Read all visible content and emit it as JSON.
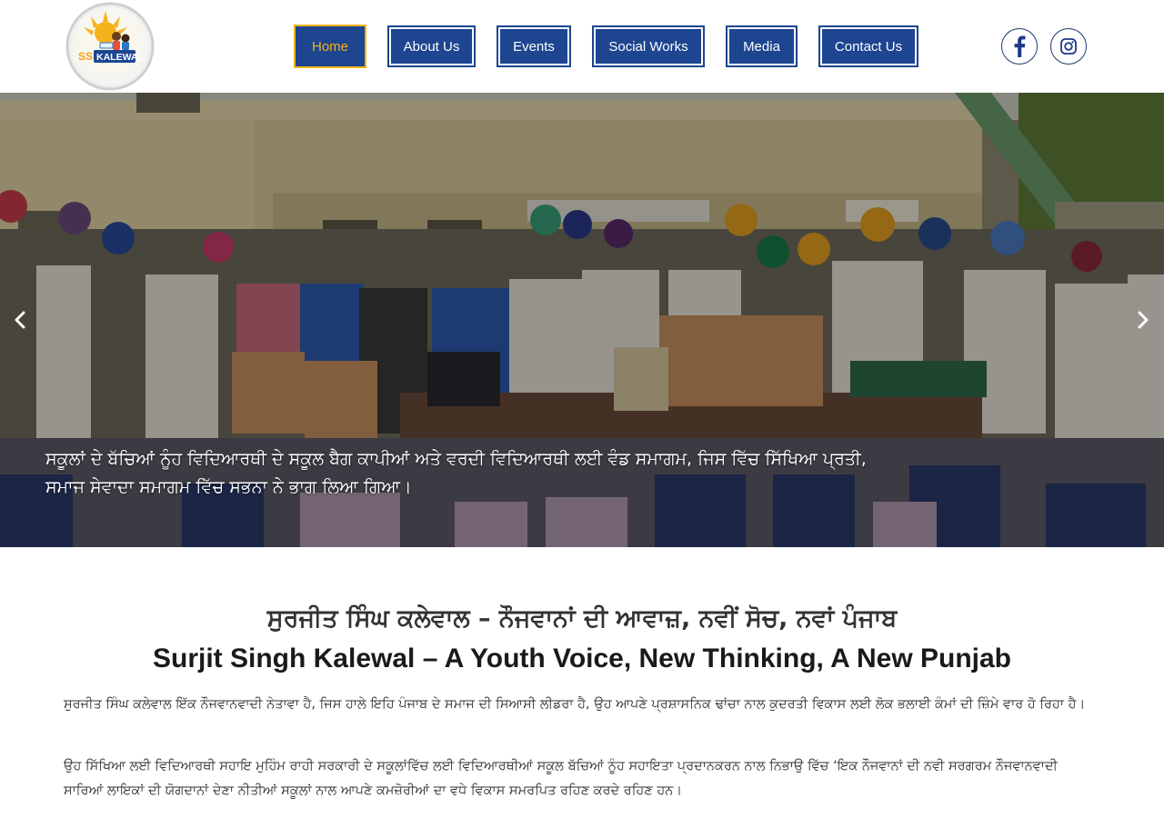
{
  "brand": {
    "logo_text": "SS KALEWAL"
  },
  "nav": {
    "items": [
      {
        "label": "Home",
        "active": true
      },
      {
        "label": "About Us"
      },
      {
        "label": "Events"
      },
      {
        "label": "Social Works"
      },
      {
        "label": "Media"
      },
      {
        "label": "Contact Us"
      }
    ]
  },
  "social": {
    "facebook_icon": "facebook-icon",
    "instagram_icon": "instagram-icon"
  },
  "hero": {
    "caption": "ਸਕੂਲਾਂ ਦੇ ਬੱਚਿਆਂ ਨੂੰਹ ਵਿਦਿਆਰਥੀ ਦੇ ਸਕੂਲ ਬੈਗ ਕਾਪੀਆਂ ਅਤੇ ਵਰਦੀ ਵਿਦਿਆਰਥੀ ਲਈ ਵੰਡ ਸਮਾਗਮ, ਜਿਸ ਵਿੱਚ ਸਿੱਖਿਆ ਪ੍ਰਤੀ, ਸਮਾਜ ਸੇਵਾਦਾ ਸਮਾਗਮ ਵਿੱਚ ਸਭਨਾ ਨੇ ਭਾਗ ਲਿਆ ਗਿਆ।",
    "prev_icon": "chevron-left-icon",
    "next_icon": "chevron-right-icon"
  },
  "intro": {
    "title_pa": "ਸੁਰਜੀਤ ਸਿੰਘ ਕਲੇਵਾਲ – ਨੌਜਵਾਨਾਂ ਦੀ ਆਵਾਜ਼, ਨਵੀਂ ਸੋਚ, ਨਵਾਂ ਪੰਜਾਬ",
    "title_en": "Surjit Singh Kalewal – A Youth Voice, New Thinking, A New Punjab",
    "para1": "ਸੁਰਜੀਤ ਸਿੰਘ ਕਲੇਵਾਲ ਇੱਕ ਨੌਜਵਾਨਵਾਦੀ ਨੇਤਾਵਾ ਹੈ, ਜਿਸ ਹਾਲੇ ਇਹਿ ਪੰਜਾਬ ਦੇ ਸਮਾਜ ਦੀ ਸਿਆਸੀ ਲੀਡਰਾ ਹੈ, ਉਹ ਆਪਣੇ ਪ੍ਰਸ਼ਾਸਨਿਕ ਢਾਂਚਾ ਨਾਲ ਕੁਦਰਤੀ ਵਿਕਾਸ ਲਈ ਲੋਕ ਭਲਾਈ ਕੰਮਾਂ ਦੀ ਜ਼ਿੰਮੇ ਵਾਰ ਹੋ ਰਿਹਾ ਹੈ।",
    "para2": "ਉਹ ਸਿੱਖਿਆ ਲਈ ਵਿਦਿਆਰਥੀ ਸਹਾਇ ਮੁਹਿੰਮ ਰਾਹੀ ਸਰਕਾਰੀ ਦੇ ਸਕੂਲਾਂਵਿੱਚ ਲਈ ਵਿਦਿਆਰਥੀਆਂ ਸਕੂਲ ਬੱਚਿਆਂ ਨੂੰਹ ਸਹਾਇਤਾ ਪ੍ਰਦਾਨਕਰਨ ਨਾਲ ਨਿਭਾਉ ਵਿੱਚ ‘ਇਕ ਨੌਜਵਾਨਾਂ ਦੀ ਨਵੀ ਸਰਗਰਮ ਨੌਜਵਾਨਵਾਦੀ ਸਾਰਿਆਂ ਲਾਇਕਾਂ ਦੀ ਯੋਗਦਾਨਾਂ ਦੇਣਾ ਨੀਤੀਆਂ ਸਕੂਲਾਂ ਨਾਲ ਆਪਣੇ ਕਮਜ਼ੋਰੀਆਂ ਦਾ ਵਧੇ ਵਿਕਾਸ ਸਮਰਪਿਤ ਰਹਿਣ ਕਰਦੇ ਰਹਿਣ ਹਨ।"
  },
  "colors": {
    "nav_bg": "#1d4590",
    "nav_active_text": "#f6b21a",
    "nav_active_border": "#f0b41c"
  }
}
